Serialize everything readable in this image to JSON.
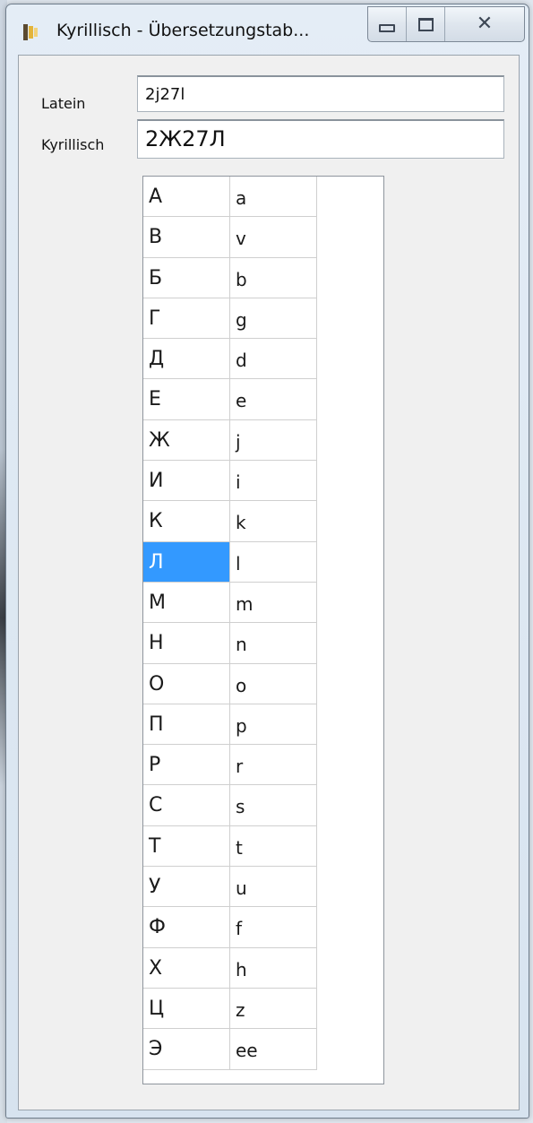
{
  "window": {
    "title": "Kyrillisch - Übersetzungstab...",
    "close_glyph": "✕"
  },
  "form": {
    "latin_label": "Latein",
    "latin_value": "2j27l",
    "cyrillic_label": "Kyrillisch",
    "cyrillic_value": "2Ж27Л"
  },
  "table": {
    "selected_row": 9,
    "rows": [
      {
        "cyr": "А",
        "lat": "a"
      },
      {
        "cyr": "В",
        "lat": "v"
      },
      {
        "cyr": "Б",
        "lat": "b"
      },
      {
        "cyr": "Г",
        "lat": "g"
      },
      {
        "cyr": "Д",
        "lat": "d"
      },
      {
        "cyr": "Е",
        "lat": "e"
      },
      {
        "cyr": "Ж",
        "lat": "j"
      },
      {
        "cyr": "И",
        "lat": "i"
      },
      {
        "cyr": "К",
        "lat": "k"
      },
      {
        "cyr": "Л",
        "lat": "l"
      },
      {
        "cyr": "М",
        "lat": "m"
      },
      {
        "cyr": "Н",
        "lat": "n"
      },
      {
        "cyr": "О",
        "lat": "o"
      },
      {
        "cyr": "П",
        "lat": "p"
      },
      {
        "cyr": "Р",
        "lat": "r"
      },
      {
        "cyr": "С",
        "lat": "s"
      },
      {
        "cyr": "Т",
        "lat": "t"
      },
      {
        "cyr": "У",
        "lat": "u"
      },
      {
        "cyr": "Ф",
        "lat": "f"
      },
      {
        "cyr": "Х",
        "lat": "h"
      },
      {
        "cyr": "Ц",
        "lat": "z"
      },
      {
        "cyr": "Э",
        "lat": "ee"
      }
    ]
  },
  "colors": {
    "selection": "#3399ff"
  }
}
